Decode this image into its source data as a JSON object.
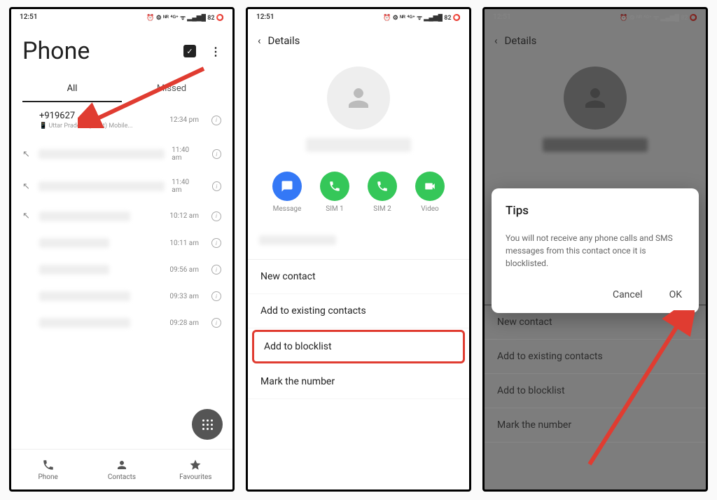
{
  "status": {
    "time": "12:51",
    "icons": "⏰ ⚙ ᴺᴿ ⁴ᴳ⁺ ᯤ ▂▄▆█ 82 ⭕"
  },
  "screen1": {
    "title": "Phone",
    "tabs": {
      "all": "All",
      "missed": "Missed"
    },
    "items": [
      {
        "num": "+919627",
        "sub": "📱 Uttar Pradesh (West) Mobile...",
        "time": "12:34 pm"
      },
      {
        "time": "11:40 am"
      },
      {
        "time": "11:40 am"
      },
      {
        "time": "10:12 am"
      },
      {
        "time": "10:11 am"
      },
      {
        "time": "09:56 am"
      },
      {
        "time": "09:33 am"
      },
      {
        "time": "09:28 am"
      }
    ],
    "bottom": {
      "phone": "Phone",
      "contacts": "Contacts",
      "favourites": "Favourites"
    }
  },
  "screen2": {
    "back": "Details",
    "actions": {
      "message": "Message",
      "sim1": "SIM 1",
      "sim2": "SIM 2",
      "video": "Video"
    },
    "menu": {
      "new_contact": "New contact",
      "add_existing": "Add to existing contacts",
      "add_blocklist": "Add to blocklist",
      "mark_number": "Mark the number"
    }
  },
  "screen3": {
    "back": "Details",
    "dialog": {
      "title": "Tips",
      "msg": "You will not receive any phone calls and SMS messages from this contact once it is blocklisted.",
      "cancel": "Cancel",
      "ok": "OK"
    },
    "menu": {
      "new_contact": "New contact",
      "add_existing": "Add to existing contacts",
      "add_blocklist": "Add to blocklist",
      "mark_number": "Mark the number"
    }
  }
}
